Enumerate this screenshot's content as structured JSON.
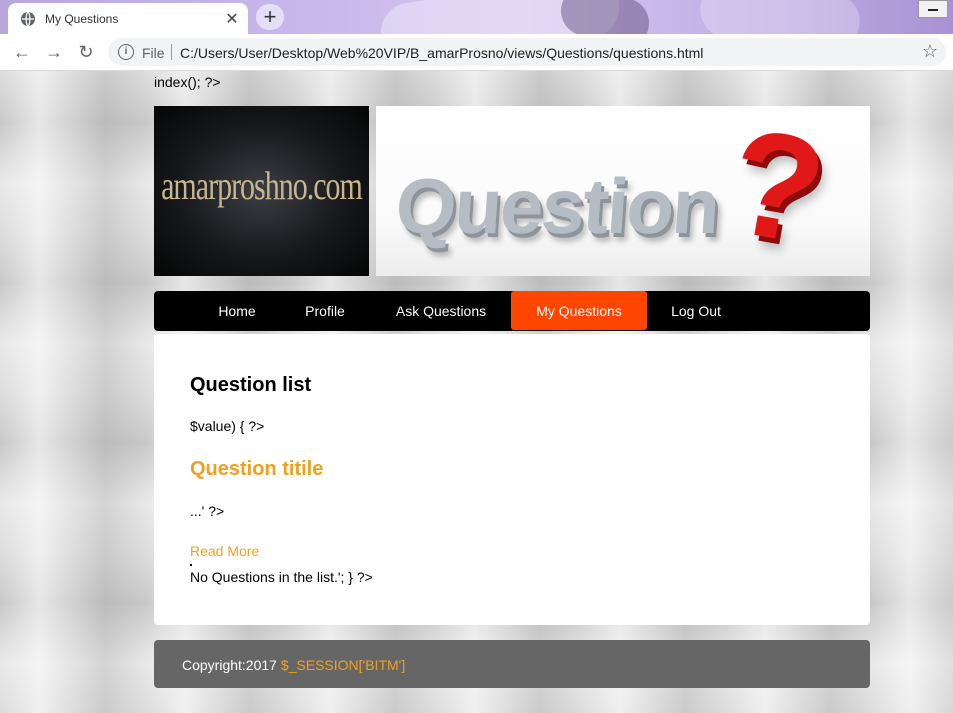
{
  "browser": {
    "tab_title": "My Questions",
    "tab_close": "✕",
    "new_tab": "+",
    "back": "←",
    "forward": "→",
    "reload": "↻",
    "info": "i",
    "file_label": "File",
    "url": "C:/Users/User/Desktop/Web%20VIP/B_amarProsno/views/Questions/questions.html",
    "star": "☆"
  },
  "page": {
    "php_top": "index(); ?>",
    "logo_text": "amarproshno.com",
    "banner_word": "Question",
    "banner_mark": "?",
    "nav": {
      "home": "Home",
      "profile": "Profile",
      "ask": "Ask Questions",
      "my_questions": "My Questions",
      "logout": "Log Out",
      "active_color": "#ff4500"
    },
    "content": {
      "heading": "Question list",
      "loop_line": "$value) { ?>",
      "question_title": "Question titile",
      "excerpt": "...' ?>",
      "read_more": "Read More",
      "empty_line": "No Questions in the list.'; } ?>"
    },
    "footer": {
      "copyright": "Copyright:2017 ",
      "session": "$_SESSION['BITM']"
    },
    "accent_color": "#f0a020"
  }
}
